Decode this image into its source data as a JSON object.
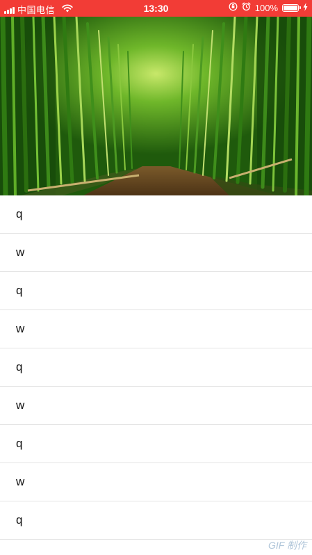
{
  "status_bar": {
    "carrier": "中国电信",
    "time": "13:30",
    "battery_percent_label": "100%",
    "battery_level": 1.0,
    "background_color": "#f23c36",
    "icons": [
      "signal-icon",
      "wifi-icon",
      "rotation-lock-icon",
      "alarm-icon",
      "battery-icon",
      "charging-icon"
    ]
  },
  "header": {
    "image": "bamboo-forest-path-image"
  },
  "list": {
    "items": [
      {
        "label": "q"
      },
      {
        "label": "w"
      },
      {
        "label": "q"
      },
      {
        "label": "w"
      },
      {
        "label": "q"
      },
      {
        "label": "w"
      },
      {
        "label": "q"
      },
      {
        "label": "w"
      },
      {
        "label": "q"
      }
    ]
  },
  "watermark": {
    "text": "GIF 制作"
  }
}
